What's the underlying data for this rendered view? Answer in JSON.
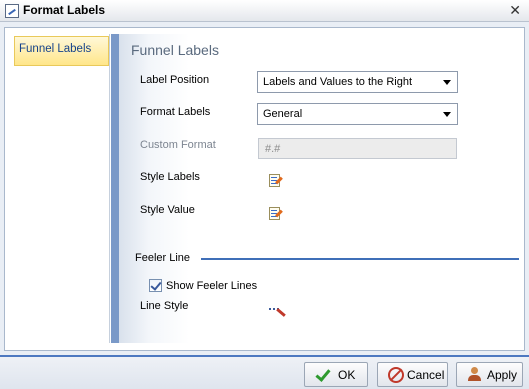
{
  "window": {
    "title": "Format Labels",
    "icon": "format-labels-icon",
    "close_icon": "close-icon"
  },
  "nav": {
    "items": [
      {
        "label": "Funnel Labels",
        "selected": true
      }
    ]
  },
  "panel": {
    "title": "Funnel Labels",
    "label_position": {
      "label": "Label Position",
      "value": "Labels and Values to the Right"
    },
    "format_labels": {
      "label": "Format Labels",
      "value": "General"
    },
    "custom_format": {
      "label": "Custom Format",
      "value": "#.#",
      "disabled": true
    },
    "style_labels": {
      "label": "Style Labels",
      "icon": "style-edit-icon"
    },
    "style_value": {
      "label": "Style Value",
      "icon": "style-edit-icon"
    },
    "feeler_section": {
      "title": "Feeler Line"
    },
    "show_feeler_lines": {
      "label": "Show Feeler Lines",
      "checked": true
    },
    "line_style": {
      "label": "Line Style",
      "icon": "line-style-icon"
    }
  },
  "buttons": {
    "ok": "OK",
    "cancel": "Cancel",
    "apply": "Apply"
  },
  "colors": {
    "accent": "#4d78c0",
    "selected_nav": "#ffe68a",
    "divider": "#7a99c8"
  }
}
